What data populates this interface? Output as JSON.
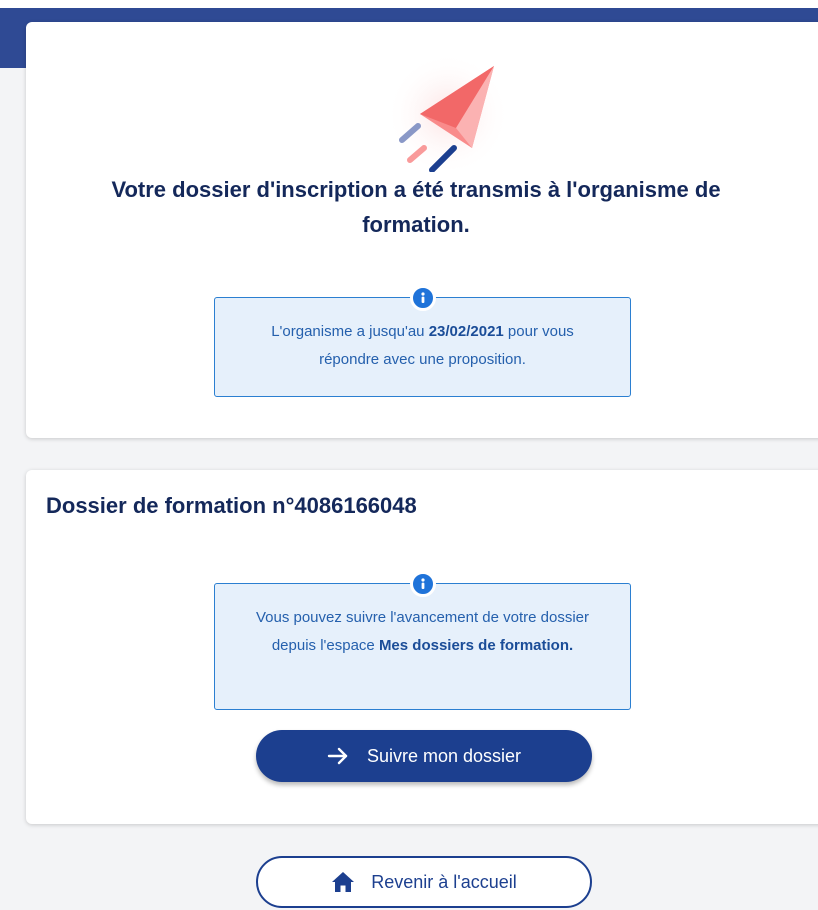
{
  "confirmation": {
    "title": "Votre dossier d'inscription a été transmis à l'organisme de formation.",
    "info": {
      "prefix": "L'organisme a jusqu'au ",
      "date": "23/02/2021",
      "suffix": " pour vous répondre avec une proposition."
    }
  },
  "dossier": {
    "title": "Dossier de formation n°4086166048",
    "info": {
      "prefix": "Vous pouvez suivre l'avancement de votre dossier depuis l'espace ",
      "link_text": "Mes dossiers de formation."
    },
    "follow_button_label": "Suivre mon dossier"
  },
  "home_button_label": "Revenir à l'accueil",
  "icons": {
    "illustration": "paper-plane-icon",
    "info": "info-icon",
    "arrow": "arrow-right-icon",
    "home": "home-icon"
  },
  "colors": {
    "header": "#2f4a94",
    "primary": "#1c3f8f",
    "title": "#14285a",
    "info_bg": "#e6f0fb",
    "info_border": "#2b7fd1",
    "info_icon": "#1f73d9",
    "plane": "#f47e7e"
  }
}
